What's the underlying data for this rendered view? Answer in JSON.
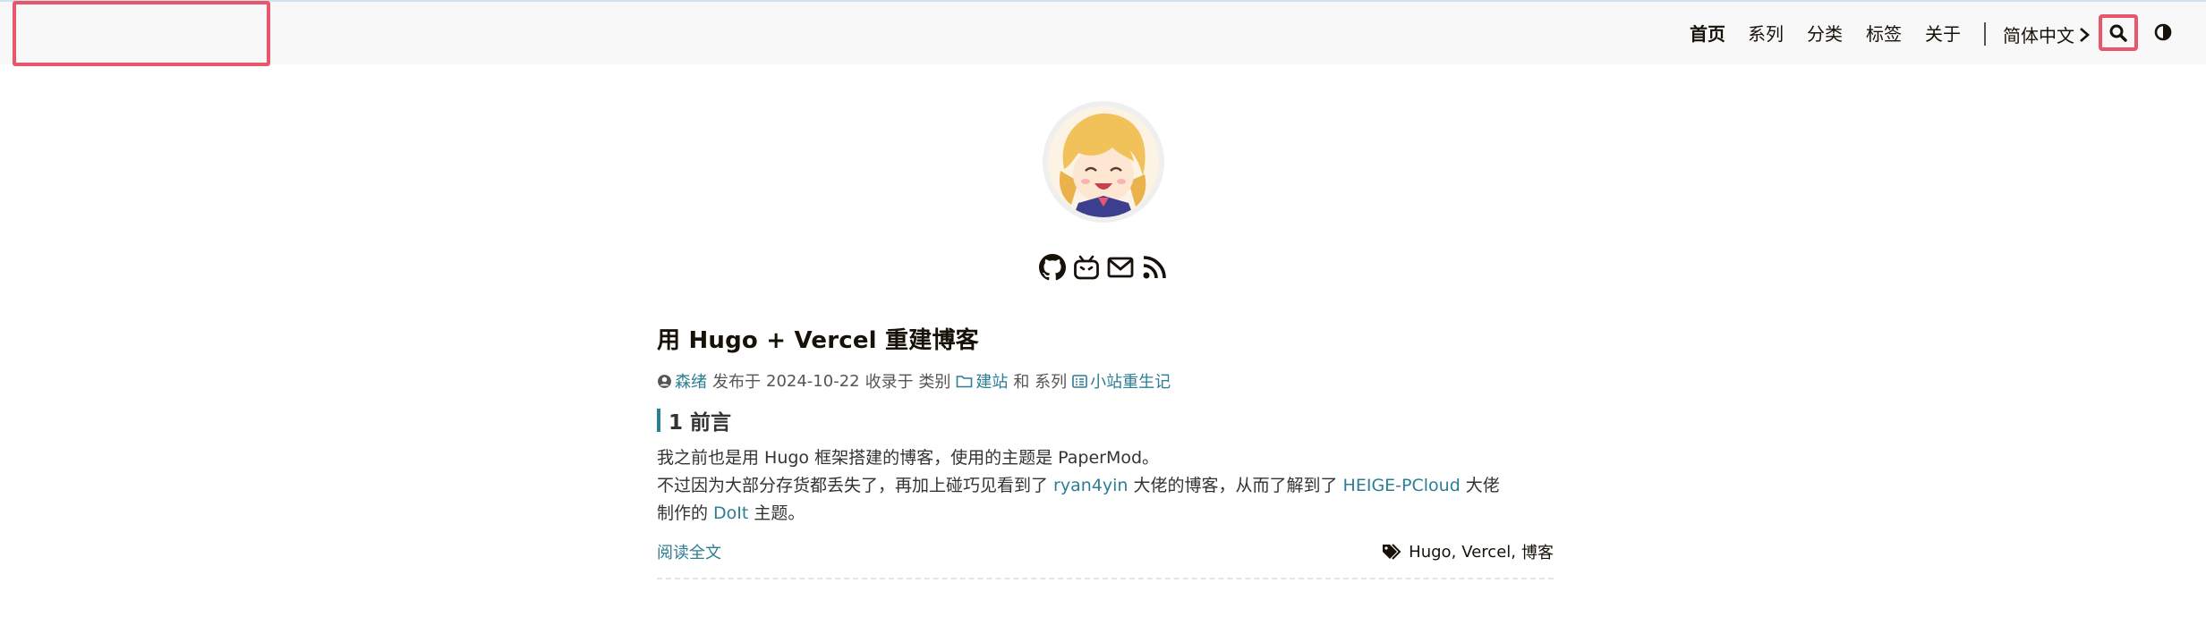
{
  "nav": {
    "items": [
      {
        "label": "首页",
        "active": true
      },
      {
        "label": "系列"
      },
      {
        "label": "分类"
      },
      {
        "label": "标签"
      },
      {
        "label": "关于"
      }
    ],
    "language": "简体中文"
  },
  "social": [
    "github-icon",
    "bilibili-icon",
    "email-icon",
    "rss-icon"
  ],
  "post": {
    "title": "用 Hugo + Vercel 重建博客",
    "author": "森绪",
    "published_prefix": "发布于",
    "date": "2024-10-22",
    "collected_in": "收录于 类别",
    "category": "建站",
    "and_series": "和 系列",
    "series": "小站重生记",
    "heading": "1 前言",
    "p1": "我之前也是用 Hugo 框架搭建的博客，使用的主题是 PaperMod。",
    "p2_a": "不过因为大部分存货都丢失了，再加上碰巧见看到了 ",
    "p2_link1": "ryan4yin",
    "p2_b": " 大佬的博客，从而了解到了 ",
    "p2_link2": "HEIGE-PCloud",
    "p2_c": " 大佬",
    "p3_a": "制作的 ",
    "p3_link": "DoIt",
    "p3_b": " 主题。",
    "read_more": "阅读全文",
    "tags": [
      "Hugo",
      "Vercel",
      "博客"
    ]
  },
  "colors": {
    "accent": "#2d7d94",
    "highlight": "#e8576b"
  }
}
